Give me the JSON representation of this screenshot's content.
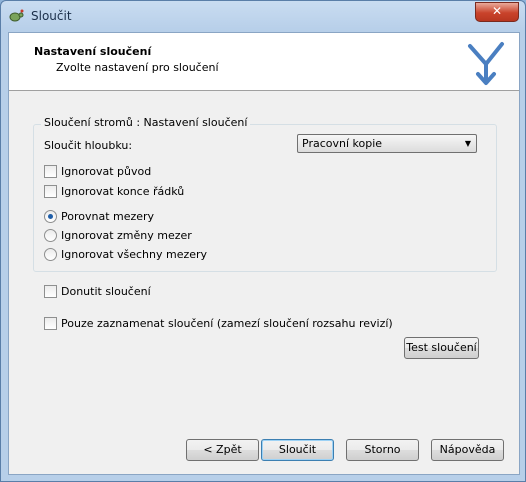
{
  "window": {
    "title": "Sloučit",
    "close_glyph": "✕"
  },
  "header": {
    "title": "Nastavení sloučení",
    "subtitle": "Zvolte nastavení pro sloučení"
  },
  "group": {
    "label": "Sloučení stromů : Nastavení sloučení",
    "depth_label": "Sloučit hloubku:",
    "depth_value": "Pracovní kopie",
    "ignore_ancestry": "Ignorovat původ",
    "ignore_eol": "Ignorovat konce řádků",
    "ws_compare": "Porovnat mezery",
    "ws_ignore_changes": "Ignorovat změny mezer",
    "ws_ignore_all": "Ignorovat všechny mezery"
  },
  "force_label": "Donutit sloučení",
  "record_only_label": "Pouze zaznamenat sloučení (zamezí sloučení rozsahu revizí)",
  "test_button": "Test sloučení",
  "buttons": {
    "back": "< Zpět",
    "merge": "Sloučit",
    "cancel": "Storno",
    "help": "Nápověda"
  },
  "colors": {
    "accent": "#1f5ea8",
    "logo": "#4a7fc1"
  }
}
